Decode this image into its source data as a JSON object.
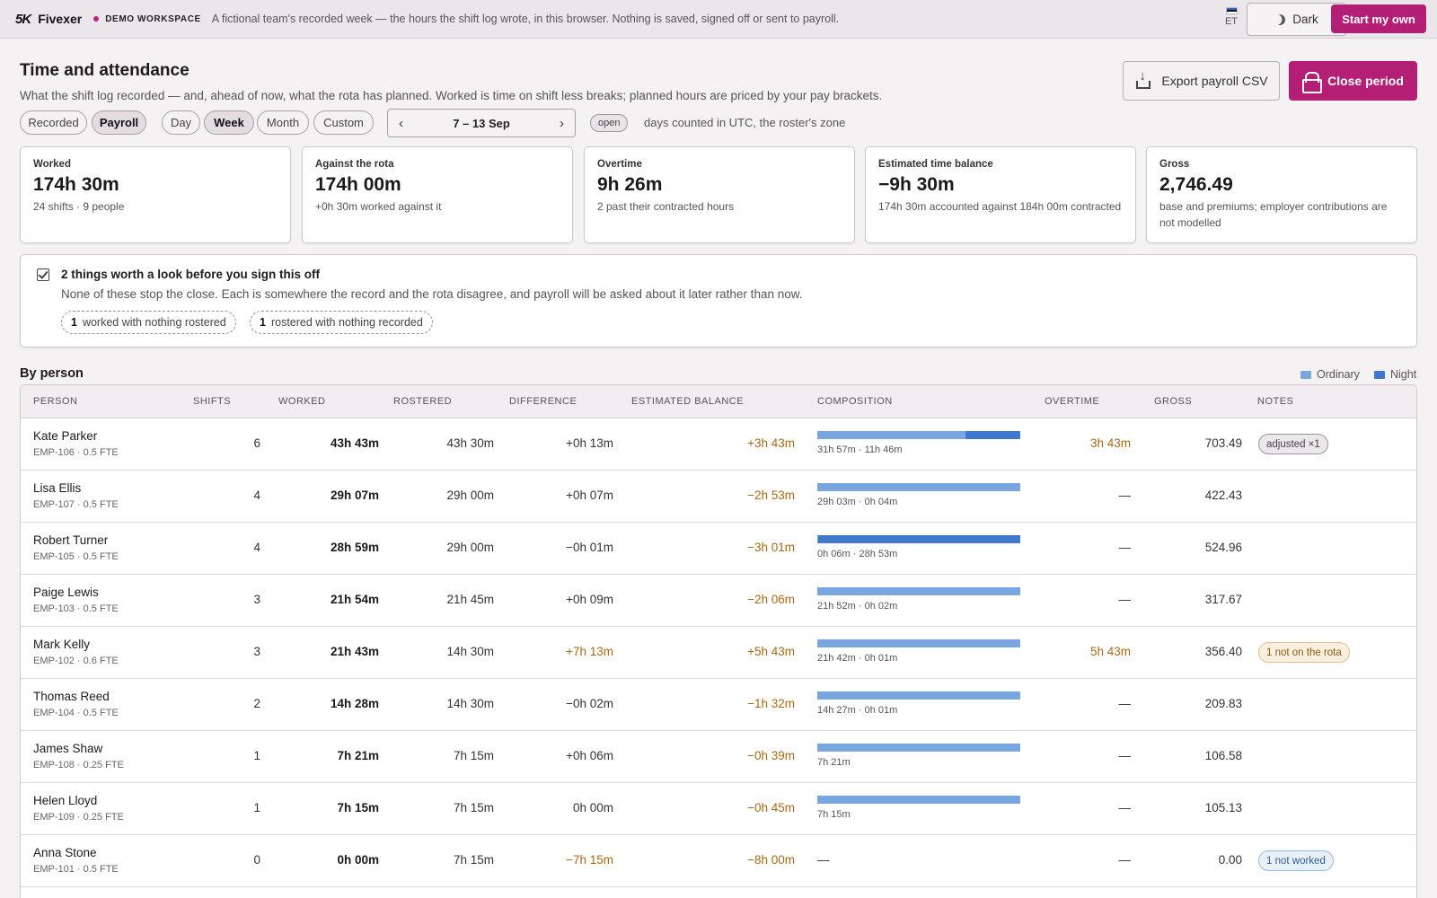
{
  "topbar": {
    "brand_mark": "5K",
    "brand_name": "Fivexer",
    "workspace": "DEMO WORKSPACE",
    "note": "A fictional team's recorded week — the hours the shift log wrote, in this browser. Nothing is saved, signed off or sent to payroll.",
    "locale": "ET",
    "dark_label": "Dark",
    "start_label": "Start my own"
  },
  "header": {
    "title": "Time and attendance",
    "subtitle": "What the shift log recorded — and, ahead of now, what the rota has planned. Worked is time on shift less breaks; planned hours are priced by your pay brackets.",
    "export_label": "Export payroll CSV",
    "close_label": "Close period"
  },
  "filters": {
    "views": [
      "Recorded",
      "Payroll"
    ],
    "active_view": "Payroll",
    "ranges": [
      "Day",
      "Week",
      "Month",
      "Custom"
    ],
    "active_range": "Week",
    "period": "7 – 13 Sep",
    "status": "open",
    "tz_note": "days counted in UTC, the roster's zone"
  },
  "kpis": [
    {
      "label": "Worked",
      "value": "174h 30m",
      "note": "24 shifts · 9 people"
    },
    {
      "label": "Against the rota",
      "value": "174h 00m",
      "note": "+0h 30m worked against it"
    },
    {
      "label": "Overtime",
      "value": "9h 26m",
      "note": "2 past their contracted hours"
    },
    {
      "label": "Estimated time balance",
      "value": "−9h 30m",
      "note": "174h 30m accounted against 184h 00m contracted"
    },
    {
      "label": "Gross",
      "value": "2,746.49",
      "note": "base and premiums; employer contributions are not modelled"
    }
  ],
  "alert": {
    "title": "2 things worth a look before you sign this off",
    "text": "None of these stop the close. Each is somewhere the record and the rota disagree, and payroll will be asked about it later rather than now.",
    "chips": [
      {
        "count": "1",
        "label": "worked with nothing rostered"
      },
      {
        "count": "1",
        "label": "rostered with nothing recorded"
      }
    ]
  },
  "table": {
    "title": "By person",
    "legend": [
      {
        "label": "Ordinary",
        "color": "#7aa6e0"
      },
      {
        "label": "Night",
        "color": "#3f78cf"
      }
    ],
    "columns": {
      "person": "PERSON",
      "shifts": "SHIFTS",
      "worked": "WORKED",
      "rostered": "ROSTERED",
      "difference": "DIFFERENCE",
      "balance": "ESTIMATED BALANCE",
      "composition": "COMPOSITION",
      "overtime": "OVERTIME",
      "gross": "GROSS",
      "notes": "NOTES"
    },
    "rows": [
      {
        "name": "Kate Parker",
        "id": "EMP-106 · 0.5 FTE",
        "shifts": "6",
        "worked": "43h 43m",
        "rostered": "43h 30m",
        "difference": "+0h 13m",
        "balance": "+3h 43m",
        "ordinary_frac": 0.73,
        "night_frac": 0.27,
        "composition": "31h 57m · 11h 46m",
        "overtime": "3h 43m",
        "gross": "703.49",
        "note": "adjusted ×1",
        "note_kind": "grey"
      },
      {
        "name": "Lisa Ellis",
        "id": "EMP-107 · 0.5 FTE",
        "shifts": "4",
        "worked": "29h 07m",
        "rostered": "29h 00m",
        "difference": "+0h 07m",
        "balance": "−2h 53m",
        "ordinary_frac": 0.998,
        "night_frac": 0.002,
        "composition": "29h 03m · 0h 04m",
        "overtime": "—",
        "gross": "422.43",
        "note": "",
        "note_kind": ""
      },
      {
        "name": "Robert Turner",
        "id": "EMP-105 · 0.5 FTE",
        "shifts": "4",
        "worked": "28h 59m",
        "rostered": "29h 00m",
        "difference": "−0h 01m",
        "balance": "−3h 01m",
        "ordinary_frac": 0.003,
        "night_frac": 0.997,
        "composition": "0h 06m · 28h 53m",
        "overtime": "—",
        "gross": "524.96",
        "note": "",
        "note_kind": ""
      },
      {
        "name": "Paige Lewis",
        "id": "EMP-103 · 0.5 FTE",
        "shifts": "3",
        "worked": "21h 54m",
        "rostered": "21h 45m",
        "difference": "+0h 09m",
        "balance": "−2h 06m",
        "ordinary_frac": 0.998,
        "night_frac": 0.002,
        "composition": "21h 52m · 0h 02m",
        "overtime": "—",
        "gross": "317.67",
        "note": "",
        "note_kind": ""
      },
      {
        "name": "Mark Kelly",
        "id": "EMP-102 · 0.6 FTE",
        "shifts": "3",
        "worked": "21h 43m",
        "rostered": "14h 30m",
        "difference": "+7h 13m",
        "balance": "+5h 43m",
        "ordinary_frac": 0.999,
        "night_frac": 0.001,
        "composition": "21h 42m · 0h 01m",
        "overtime": "5h 43m",
        "gross": "356.40",
        "note": "1 not on the rota",
        "note_kind": "amber"
      },
      {
        "name": "Thomas Reed",
        "id": "EMP-104 · 0.5 FTE",
        "shifts": "2",
        "worked": "14h 28m",
        "rostered": "14h 30m",
        "difference": "−0h 02m",
        "balance": "−1h 32m",
        "ordinary_frac": 0.999,
        "night_frac": 0.001,
        "composition": "14h 27m · 0h 01m",
        "overtime": "—",
        "gross": "209.83",
        "note": "",
        "note_kind": ""
      },
      {
        "name": "James Shaw",
        "id": "EMP-108 · 0.25 FTE",
        "shifts": "1",
        "worked": "7h 21m",
        "rostered": "7h 15m",
        "difference": "+0h 06m",
        "balance": "−0h 39m",
        "ordinary_frac": 1,
        "night_frac": 0,
        "composition": "7h 21m",
        "overtime": "—",
        "gross": "106.58",
        "note": "",
        "note_kind": ""
      },
      {
        "name": "Helen Lloyd",
        "id": "EMP-109 · 0.25 FTE",
        "shifts": "1",
        "worked": "7h 15m",
        "rostered": "7h 15m",
        "difference": "0h 00m",
        "balance": "−0h 45m",
        "ordinary_frac": 1,
        "night_frac": 0,
        "composition": "7h 15m",
        "overtime": "—",
        "gross": "105.13",
        "note": "",
        "note_kind": ""
      },
      {
        "name": "Anna Stone",
        "id": "EMP-101 · 0.5 FTE",
        "shifts": "0",
        "worked": "0h 00m",
        "rostered": "7h 15m",
        "difference": "−7h 15m",
        "balance": "−8h 00m",
        "ordinary_frac": 0,
        "night_frac": 0,
        "composition": "—",
        "overtime": "—",
        "gross": "0.00",
        "note": "1 not worked",
        "note_kind": "blue"
      }
    ]
  }
}
